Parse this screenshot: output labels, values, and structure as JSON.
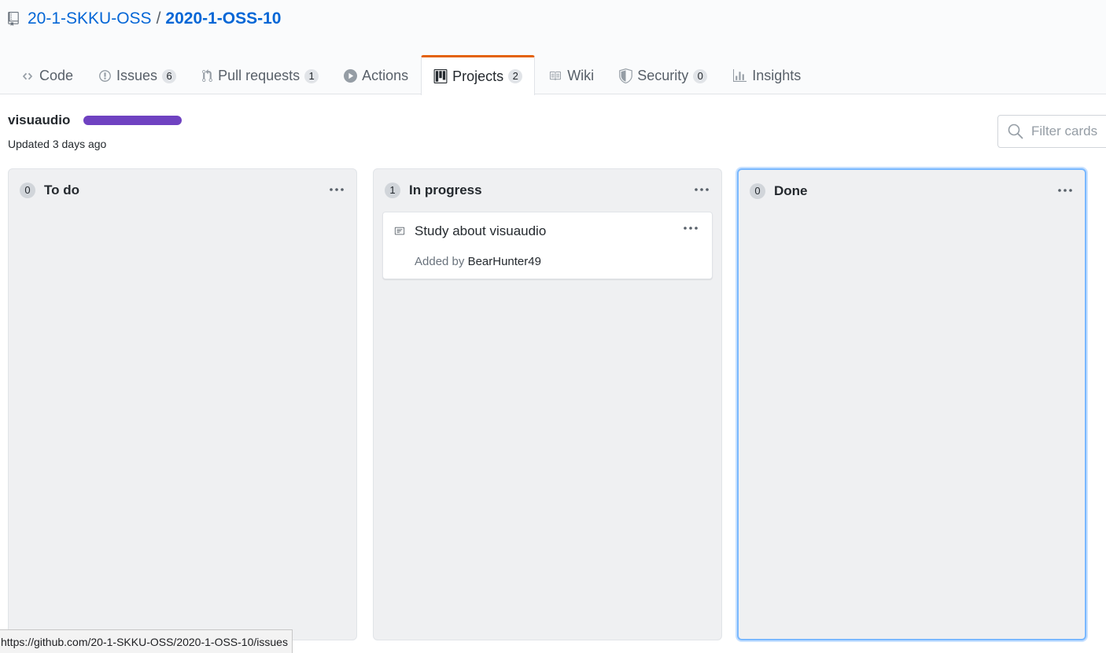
{
  "repo": {
    "owner": "20-1-SKKU-OSS",
    "separator": "/",
    "name": "2020-1-OSS-10",
    "icon": "repo-icon"
  },
  "tabs": [
    {
      "label": "Code",
      "icon": "code-icon",
      "counter": null,
      "selected": false
    },
    {
      "label": "Issues",
      "icon": "issue-icon",
      "counter": "6",
      "selected": false
    },
    {
      "label": "Pull requests",
      "icon": "pull-request-icon",
      "counter": "1",
      "selected": false
    },
    {
      "label": "Actions",
      "icon": "play-icon",
      "counter": null,
      "selected": false
    },
    {
      "label": "Projects",
      "icon": "project-icon",
      "counter": "2",
      "selected": true
    },
    {
      "label": "Wiki",
      "icon": "book-icon",
      "counter": null,
      "selected": false
    },
    {
      "label": "Security",
      "icon": "shield-icon",
      "counter": "0",
      "selected": false
    },
    {
      "label": "Insights",
      "icon": "graph-icon",
      "counter": null,
      "selected": false
    }
  ],
  "project": {
    "name": "visuaudio",
    "updated": "Updated 3 days ago",
    "progress_color": "#6f42c1"
  },
  "filter": {
    "placeholder": "Filter cards"
  },
  "columns": [
    {
      "count": "0",
      "title": "To do"
    },
    {
      "count": "1",
      "title": "In progress"
    },
    {
      "count": "0",
      "title": "Done"
    }
  ],
  "card": {
    "title": "Study about visuaudio",
    "added_by": "Added by",
    "author": "BearHunter49",
    "icon": "note-icon"
  },
  "statusbar": {
    "url": "https://github.com/20-1-SKKU-OSS/2020-1-OSS-10/issues"
  },
  "colors": {
    "link": "#0366d6",
    "selected_tab_border": "#e36209",
    "column_bg": "#eff0f2",
    "focus_border": "#79b8ff"
  }
}
